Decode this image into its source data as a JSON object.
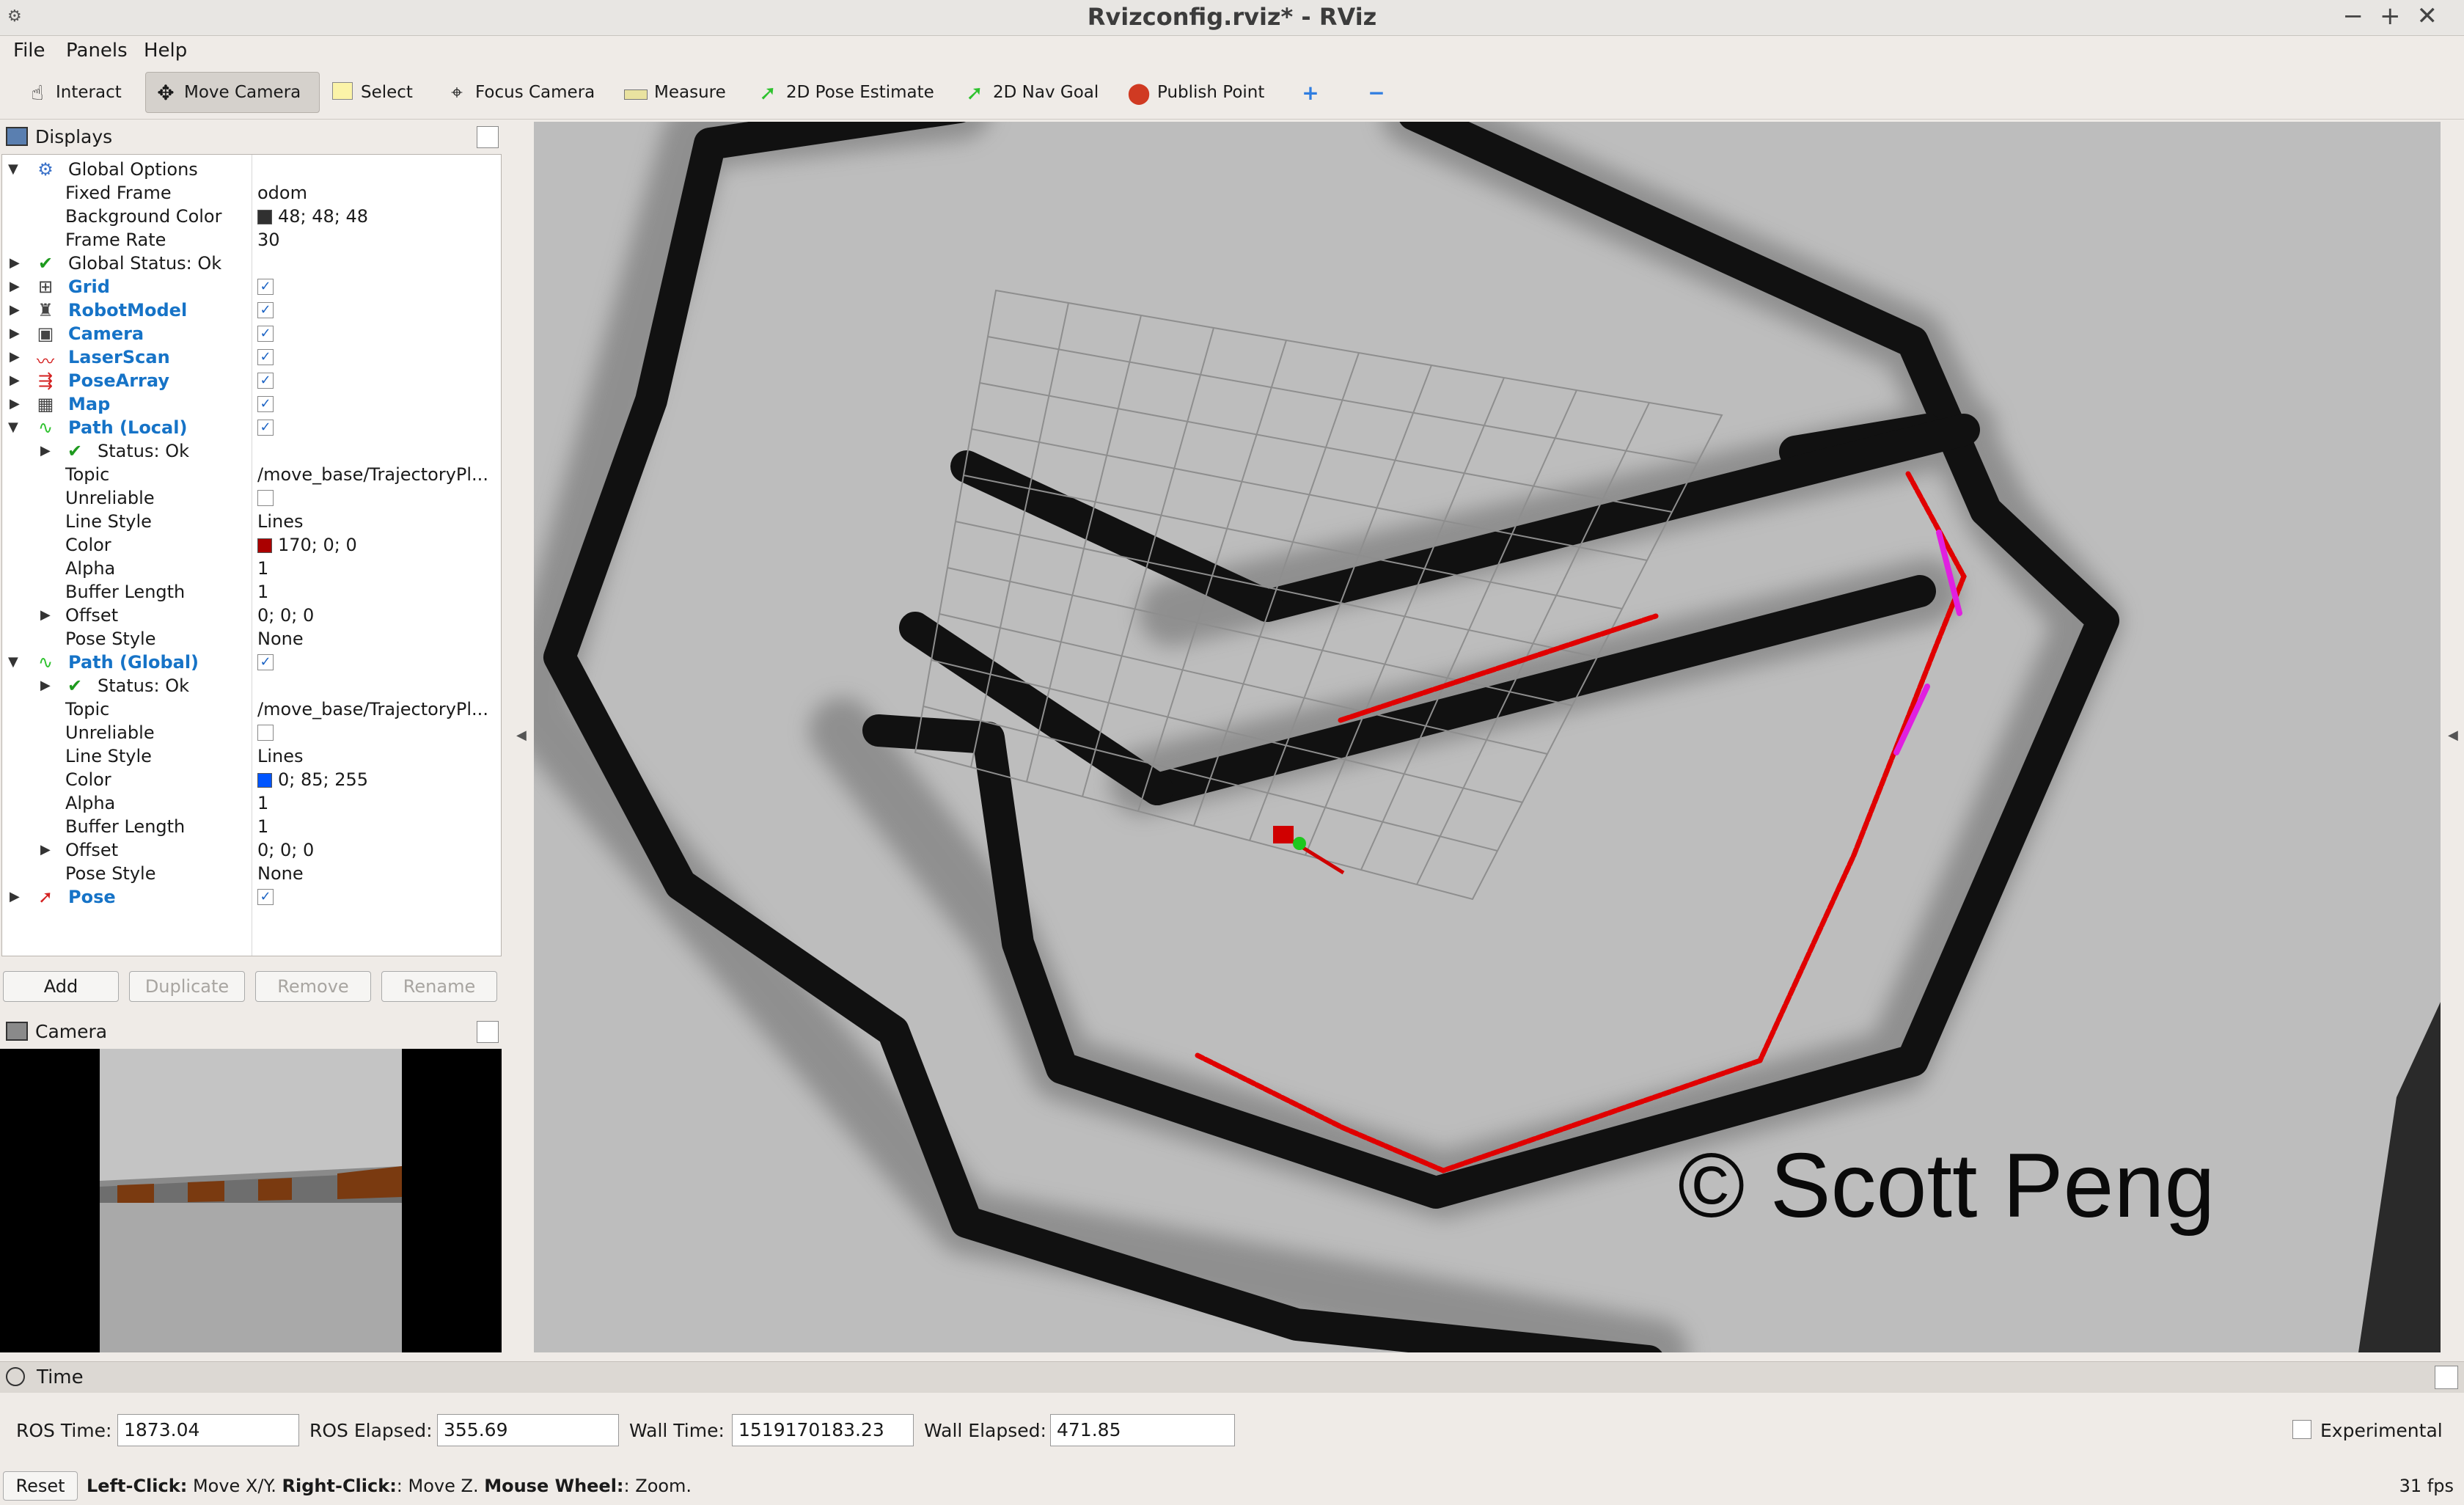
{
  "window": {
    "title": "Rvizconfig.rviz* - RViz"
  },
  "menu": [
    "File",
    "Panels",
    "Help"
  ],
  "toolbar": {
    "interact": "Interact",
    "move_camera": "Move Camera",
    "select": "Select",
    "focus_camera": "Focus Camera",
    "measure": "Measure",
    "pose_estimate": "2D Pose Estimate",
    "nav_goal": "2D Nav Goal",
    "publish_point": "Publish Point"
  },
  "displays": {
    "title": "Displays",
    "rows": [
      {
        "name": "Global Options"
      },
      {
        "name": "Fixed Frame",
        "value": "odom"
      },
      {
        "name": "Background Color",
        "value": "48; 48; 48",
        "color": "#303030"
      },
      {
        "name": "Frame Rate",
        "value": "30"
      },
      {
        "name": "Global Status: Ok"
      },
      {
        "name": "Grid"
      },
      {
        "name": "RobotModel"
      },
      {
        "name": "Camera"
      },
      {
        "name": "LaserScan"
      },
      {
        "name": "PoseArray"
      },
      {
        "name": "Map"
      },
      {
        "name": "Path (Local)"
      },
      {
        "name": "Status: Ok"
      },
      {
        "name": "Topic",
        "value": "/move_base/TrajectoryPl..."
      },
      {
        "name": "Unreliable"
      },
      {
        "name": "Line Style",
        "value": "Lines"
      },
      {
        "name": "Color",
        "value": "170; 0; 0",
        "color": "#aa0000"
      },
      {
        "name": "Alpha",
        "value": "1"
      },
      {
        "name": "Buffer Length",
        "value": "1"
      },
      {
        "name": "Offset",
        "value": "0; 0; 0"
      },
      {
        "name": "Pose Style",
        "value": "None"
      },
      {
        "name": "Path (Global)"
      },
      {
        "name": "Status: Ok"
      },
      {
        "name": "Topic",
        "value": "/move_base/TrajectoryPl..."
      },
      {
        "name": "Unreliable"
      },
      {
        "name": "Line Style",
        "value": "Lines"
      },
      {
        "name": "Color",
        "value": "0; 85; 255",
        "color": "#0055ff"
      },
      {
        "name": "Alpha",
        "value": "1"
      },
      {
        "name": "Buffer Length",
        "value": "1"
      },
      {
        "name": "Offset",
        "value": "0; 0; 0"
      },
      {
        "name": "Pose Style",
        "value": "None"
      },
      {
        "name": "Pose"
      }
    ],
    "buttons": {
      "add": "Add",
      "duplicate": "Duplicate",
      "remove": "Remove",
      "rename": "Rename"
    }
  },
  "camera_panel": {
    "title": "Camera"
  },
  "viewport": {
    "watermark": "© Scott Peng"
  },
  "time": {
    "title": "Time",
    "ros_time_label": "ROS Time:",
    "ros_time": "1873.04",
    "ros_elapsed_label": "ROS Elapsed:",
    "ros_elapsed": "355.69",
    "wall_time_label": "Wall Time:",
    "wall_time": "1519170183.23",
    "wall_elapsed_label": "Wall Elapsed:",
    "wall_elapsed": "471.85",
    "experimental": "Experimental"
  },
  "status": {
    "reset": "Reset",
    "left_click_label": "Left-Click:",
    "left_click": "Move X/Y.",
    "right_click_label": "Right-Click:",
    "right_click": ": Move Z.",
    "wheel_label": "Mouse Wheel:",
    "wheel": ": Zoom.",
    "fps": "31 fps"
  }
}
